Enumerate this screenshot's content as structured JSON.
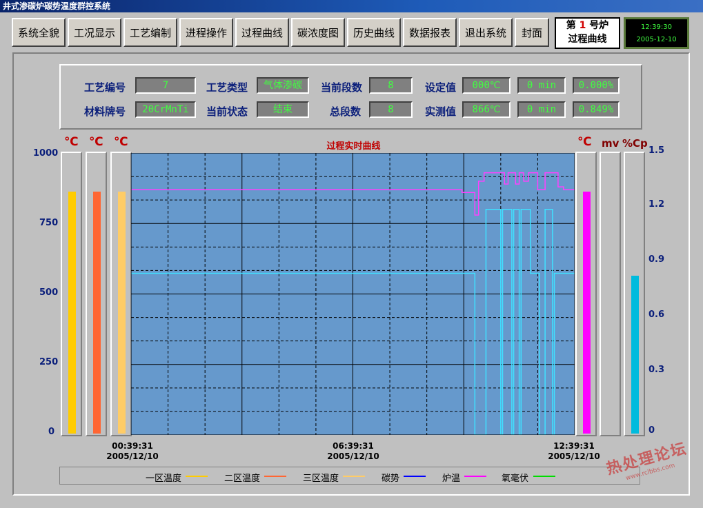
{
  "window": {
    "title": "井式渗碳炉碳势温度群控系统"
  },
  "menu": [
    {
      "label": "系统全貌"
    },
    {
      "label": "工况显示"
    },
    {
      "label": "工艺编制"
    },
    {
      "label": "进程操作"
    },
    {
      "label": "过程曲线"
    },
    {
      "label": "碳浓度图"
    },
    {
      "label": "历史曲线"
    },
    {
      "label": "数据报表"
    },
    {
      "label": "退出系统"
    },
    {
      "label": "封面"
    }
  ],
  "furnace": {
    "prefix": "第",
    "number": "1",
    "suffix": "号炉",
    "subtitle": "过程曲线"
  },
  "clock": {
    "time": "12:39:30",
    "date": "2005-12-10"
  },
  "info": {
    "process_no_label": "工艺编号",
    "process_no": "7",
    "material_label": "材料牌号",
    "material": "20CrMnTi",
    "process_type_label": "工艺类型",
    "process_type": "气体渗碳",
    "status_label": "当前状态",
    "status": "结束",
    "current_seg_label": "当前段数",
    "current_seg": "8",
    "total_seg_label": "总段数",
    "total_seg": "8",
    "setpoint_label": "设定值",
    "set_temp": "000℃",
    "set_time": "0 min",
    "set_cp": "0.000%",
    "measured_label": "实测值",
    "act_temp": "866℃",
    "act_time": "0 min",
    "act_cp": "0.849%"
  },
  "units": {
    "left1": "℃",
    "left2": "℃",
    "left3": "℃",
    "right1": "℃",
    "right2": "mv",
    "right3": "%Cp"
  },
  "chart_data": {
    "type": "line",
    "title": "过程实时曲线",
    "y_left": {
      "ticks": [
        "1000",
        "750",
        "500",
        "250",
        "0"
      ],
      "range": [
        0,
        1000
      ]
    },
    "y_right": {
      "ticks": [
        "1.5",
        "1.2",
        "0.9",
        "0.6",
        "0.3",
        "0"
      ],
      "range": [
        0,
        1.5
      ]
    },
    "x_ticks": [
      {
        "time": "00:39:31",
        "date": "2005/12/10"
      },
      {
        "time": "06:39:31",
        "date": "2005/12/10"
      },
      {
        "time": "12:39:31",
        "date": "2005/12/10"
      }
    ],
    "x_range_hours": [
      0,
      12
    ],
    "grid": true,
    "series": [
      {
        "name": "炉温",
        "color": "#ff40ff",
        "axis": "left",
        "points": [
          [
            0,
            870
          ],
          [
            8.95,
            870
          ],
          [
            8.95,
            860
          ],
          [
            9.3,
            860
          ],
          [
            9.3,
            780
          ],
          [
            9.4,
            780
          ],
          [
            9.4,
            900
          ],
          [
            9.55,
            900
          ],
          [
            9.55,
            930
          ],
          [
            10.1,
            930
          ],
          [
            10.1,
            890
          ],
          [
            10.2,
            890
          ],
          [
            10.2,
            930
          ],
          [
            10.4,
            930
          ],
          [
            10.4,
            890
          ],
          [
            10.5,
            890
          ],
          [
            10.5,
            930
          ],
          [
            10.62,
            930
          ],
          [
            10.62,
            900
          ],
          [
            10.75,
            900
          ],
          [
            10.75,
            930
          ],
          [
            11.0,
            930
          ],
          [
            11.0,
            870
          ],
          [
            11.2,
            870
          ],
          [
            11.2,
            930
          ],
          [
            11.55,
            930
          ],
          [
            11.55,
            880
          ],
          [
            11.7,
            880
          ],
          [
            11.7,
            870
          ],
          [
            12,
            870
          ]
        ]
      },
      {
        "name": "碳势",
        "color": "#40e0ff",
        "axis": "right",
        "points": [
          [
            0,
            0.86
          ],
          [
            9.3,
            0.86
          ],
          [
            9.3,
            0
          ],
          [
            9.6,
            0
          ],
          [
            9.6,
            1.2
          ],
          [
            10.0,
            1.2
          ],
          [
            10.0,
            0
          ],
          [
            10.05,
            0
          ],
          [
            10.05,
            1.2
          ],
          [
            10.3,
            1.2
          ],
          [
            10.3,
            0
          ],
          [
            10.35,
            0
          ],
          [
            10.35,
            1.2
          ],
          [
            10.5,
            1.2
          ],
          [
            10.5,
            0
          ],
          [
            10.55,
            0
          ],
          [
            10.55,
            1.2
          ],
          [
            10.8,
            1.2
          ],
          [
            10.8,
            0.86
          ],
          [
            11.05,
            0.86
          ],
          [
            11.05,
            0
          ],
          [
            11.2,
            0
          ],
          [
            11.2,
            1.2
          ],
          [
            11.4,
            1.2
          ],
          [
            11.4,
            0
          ],
          [
            11.45,
            0
          ],
          [
            11.45,
            0.86
          ],
          [
            12,
            0.86
          ]
        ]
      }
    ],
    "gauges": [
      {
        "unit": "℃",
        "value": 866,
        "color": "#ffcc00"
      },
      {
        "unit": "℃",
        "value": 866,
        "color": "#ff6633"
      },
      {
        "unit": "℃",
        "value": 866,
        "color": "#ffcc66"
      },
      {
        "unit": "℃",
        "value": 866,
        "color": "#ff00ff"
      },
      {
        "unit": "mv",
        "value": 0,
        "color": "#00ff00"
      },
      {
        "unit": "%Cp",
        "value": 0.849,
        "color": "#00bbdd"
      }
    ]
  },
  "legend": [
    {
      "label": "一区温度",
      "color": "#ffcc00"
    },
    {
      "label": "二区温度",
      "color": "#ff6633"
    },
    {
      "label": "三区温度",
      "color": "#ffcc66"
    },
    {
      "label": "碳势",
      "color": "#0000ff"
    },
    {
      "label": "炉温",
      "color": "#ff00ff"
    },
    {
      "label": "氧毫伏",
      "color": "#00dd00"
    }
  ],
  "watermark": {
    "text": "热处理论坛",
    "url": "www.rclbbs.com"
  }
}
